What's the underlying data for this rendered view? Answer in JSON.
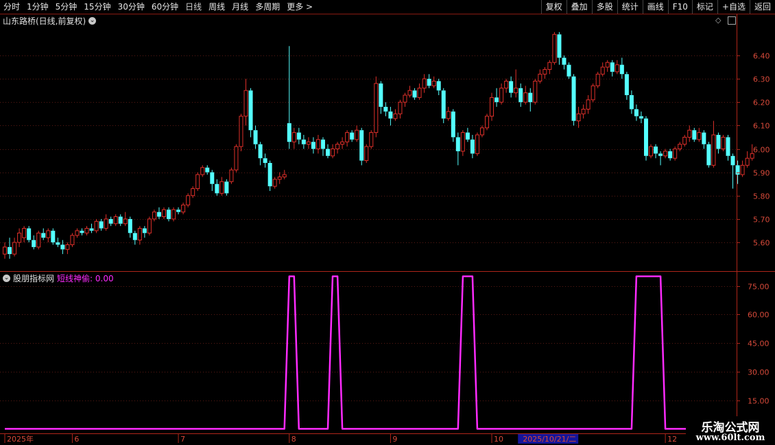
{
  "toolbar": {
    "periods": [
      "分时",
      "1分钟",
      "5分钟",
      "15分钟",
      "30分钟",
      "60分钟",
      "日线",
      "周线",
      "月线",
      "多周期",
      "更多 >"
    ],
    "active_period": "日线",
    "right_buttons": [
      "复权",
      "叠加",
      "多股",
      "统计",
      "画线",
      "F10",
      "标记",
      "+自选",
      "返回"
    ]
  },
  "main_panel": {
    "title": "山东路桥(日线,前复权)",
    "price_ticks": [
      "6.40",
      "6.30",
      "6.20",
      "6.10",
      "6.00",
      "5.90",
      "5.80",
      "5.70",
      "5.60"
    ],
    "price_range": [
      5.48,
      6.52
    ],
    "up_color": "#e0302a",
    "down_color": "#54ffff"
  },
  "indicator_panel": {
    "source": "股朋指标网",
    "indicator_label": "短线神偷: 0.00",
    "ticks": [
      "75.00",
      "60.00",
      "45.00",
      "30.00",
      "15.00"
    ],
    "value_range": [
      -2,
      82
    ],
    "line_color": "#ff2bff"
  },
  "date_axis": {
    "labels": [
      {
        "text": "2025年",
        "i": 0
      },
      {
        "text": "6",
        "i": 14
      },
      {
        "text": "7",
        "i": 36
      },
      {
        "text": "8",
        "i": 59
      },
      {
        "text": "9",
        "i": 80
      },
      {
        "text": "10",
        "i": 101
      },
      {
        "text": "2025/10/21/二",
        "i": 107,
        "highlight": true
      },
      {
        "text": "12",
        "i": 137
      }
    ]
  },
  "watermark": {
    "line1": "乐淘公式网",
    "line2": "www.60lt.com"
  },
  "chart_data": {
    "type": "candlestick",
    "candles": [
      [
        5.55,
        5.58,
        5.53,
        5.6
      ],
      [
        5.58,
        5.55,
        5.53,
        5.62
      ],
      [
        5.55,
        5.6,
        5.54,
        5.62
      ],
      [
        5.6,
        5.64,
        5.58,
        5.66
      ],
      [
        5.62,
        5.66,
        5.6,
        5.67
      ],
      [
        5.66,
        5.61,
        5.6,
        5.67
      ],
      [
        5.61,
        5.58,
        5.57,
        5.63
      ],
      [
        5.58,
        5.64,
        5.57,
        5.65
      ],
      [
        5.64,
        5.62,
        5.61,
        5.66
      ],
      [
        5.62,
        5.65,
        5.6,
        5.66
      ],
      [
        5.65,
        5.6,
        5.59,
        5.66
      ],
      [
        5.6,
        5.59,
        5.58,
        5.62
      ],
      [
        5.59,
        5.57,
        5.55,
        5.61
      ],
      [
        5.57,
        5.59,
        5.55,
        5.6
      ],
      [
        5.59,
        5.63,
        5.58,
        5.64
      ],
      [
        5.63,
        5.65,
        5.62,
        5.66
      ],
      [
        5.65,
        5.64,
        5.63,
        5.66
      ],
      [
        5.64,
        5.66,
        5.63,
        5.67
      ],
      [
        5.66,
        5.65,
        5.64,
        5.68
      ],
      [
        5.65,
        5.69,
        5.64,
        5.7
      ],
      [
        5.69,
        5.66,
        5.65,
        5.7
      ],
      [
        5.66,
        5.7,
        5.65,
        5.72
      ],
      [
        5.7,
        5.68,
        5.67,
        5.71
      ],
      [
        5.68,
        5.71,
        5.67,
        5.72
      ],
      [
        5.71,
        5.68,
        5.67,
        5.72
      ],
      [
        5.68,
        5.7,
        5.67,
        5.73
      ],
      [
        5.7,
        5.64,
        5.62,
        5.71
      ],
      [
        5.64,
        5.61,
        5.59,
        5.65
      ],
      [
        5.61,
        5.66,
        5.59,
        5.67
      ],
      [
        5.66,
        5.64,
        5.62,
        5.67
      ],
      [
        5.64,
        5.7,
        5.63,
        5.71
      ],
      [
        5.7,
        5.73,
        5.69,
        5.74
      ],
      [
        5.73,
        5.71,
        5.7,
        5.75
      ],
      [
        5.71,
        5.74,
        5.7,
        5.75
      ],
      [
        5.74,
        5.7,
        5.69,
        5.75
      ],
      [
        5.7,
        5.74,
        5.69,
        5.75
      ],
      [
        5.74,
        5.73,
        5.72,
        5.75
      ],
      [
        5.73,
        5.76,
        5.72,
        5.77
      ],
      [
        5.76,
        5.8,
        5.75,
        5.81
      ],
      [
        5.8,
        5.83,
        5.79,
        5.84
      ],
      [
        5.83,
        5.89,
        5.82,
        5.9
      ],
      [
        5.89,
        5.92,
        5.88,
        5.93
      ],
      [
        5.92,
        5.9,
        5.89,
        5.93
      ],
      [
        5.9,
        5.85,
        5.82,
        5.91
      ],
      [
        5.85,
        5.81,
        5.8,
        5.87
      ],
      [
        5.81,
        5.86,
        5.8,
        5.88
      ],
      [
        5.86,
        5.81,
        5.8,
        5.87
      ],
      [
        5.86,
        5.91,
        5.85,
        5.92
      ],
      [
        5.91,
        6.01,
        5.9,
        6.02
      ],
      [
        6.01,
        6.14,
        5.99,
        6.15
      ],
      [
        6.14,
        6.25,
        6.1,
        6.3
      ],
      [
        6.25,
        6.08,
        6.05,
        6.26
      ],
      [
        6.08,
        6.02,
        6.0,
        6.1
      ],
      [
        6.02,
        5.96,
        5.93,
        6.03
      ],
      [
        5.96,
        5.94,
        5.92,
        5.98
      ],
      [
        5.94,
        5.84,
        5.82,
        5.95
      ],
      [
        5.84,
        5.87,
        5.83,
        5.88
      ],
      [
        5.87,
        5.88,
        5.85,
        5.9
      ],
      [
        5.88,
        5.89,
        5.87,
        5.91
      ],
      [
        6.11,
        6.03,
        6.0,
        6.44
      ],
      [
        6.03,
        6.07,
        6.0,
        6.09
      ],
      [
        6.07,
        6.04,
        6.02,
        6.09
      ],
      [
        6.04,
        6.02,
        6.0,
        6.06
      ],
      [
        6.02,
        6.03,
        6.0,
        6.05
      ],
      [
        6.03,
        6.0,
        5.98,
        6.05
      ],
      [
        6.0,
        6.04,
        5.98,
        6.06
      ],
      [
        6.04,
        6.0,
        5.97,
        6.05
      ],
      [
        6.0,
        5.97,
        5.96,
        6.02
      ],
      [
        5.97,
        6.0,
        5.96,
        6.02
      ],
      [
        6.0,
        6.02,
        5.98,
        6.03
      ],
      [
        6.02,
        6.03,
        6.0,
        6.05
      ],
      [
        6.03,
        6.07,
        6.01,
        6.08
      ],
      [
        6.07,
        6.04,
        6.03,
        6.08
      ],
      [
        6.04,
        6.08,
        6.03,
        6.1
      ],
      [
        6.08,
        5.95,
        5.93,
        6.09
      ],
      [
        5.95,
        6.01,
        5.94,
        6.02
      ],
      [
        6.01,
        6.07,
        6.0,
        6.08
      ],
      [
        6.07,
        6.28,
        6.05,
        6.31
      ],
      [
        6.28,
        6.18,
        6.15,
        6.29
      ],
      [
        6.18,
        6.16,
        6.14,
        6.2
      ],
      [
        6.16,
        6.13,
        6.1,
        6.18
      ],
      [
        6.13,
        6.15,
        6.12,
        6.17
      ],
      [
        6.15,
        6.2,
        6.13,
        6.21
      ],
      [
        6.2,
        6.23,
        6.18,
        6.24
      ],
      [
        6.23,
        6.25,
        6.22,
        6.27
      ],
      [
        6.25,
        6.22,
        6.21,
        6.26
      ],
      [
        6.22,
        6.26,
        6.21,
        6.28
      ],
      [
        6.26,
        6.3,
        6.24,
        6.32
      ],
      [
        6.3,
        6.27,
        6.26,
        6.32
      ],
      [
        6.27,
        6.29,
        6.26,
        6.31
      ],
      [
        6.29,
        6.25,
        6.23,
        6.3
      ],
      [
        6.25,
        6.13,
        6.11,
        6.26
      ],
      [
        6.13,
        6.16,
        6.12,
        6.18
      ],
      [
        6.16,
        6.05,
        6.03,
        6.17
      ],
      [
        6.05,
        5.99,
        5.93,
        6.07
      ],
      [
        5.99,
        6.07,
        5.97,
        6.08
      ],
      [
        6.07,
        6.04,
        6.03,
        6.09
      ],
      [
        6.04,
        5.98,
        5.96,
        6.06
      ],
      [
        5.98,
        6.06,
        5.97,
        6.07
      ],
      [
        6.06,
        6.09,
        6.05,
        6.1
      ],
      [
        6.09,
        6.14,
        6.08,
        6.15
      ],
      [
        6.14,
        6.22,
        6.12,
        6.24
      ],
      [
        6.22,
        6.2,
        6.18,
        6.26
      ],
      [
        6.2,
        6.26,
        6.19,
        6.28
      ],
      [
        6.26,
        6.29,
        6.24,
        6.3
      ],
      [
        6.29,
        6.24,
        6.22,
        6.31
      ],
      [
        6.24,
        6.26,
        6.22,
        6.34
      ],
      [
        6.26,
        6.2,
        6.18,
        6.28
      ],
      [
        6.2,
        6.24,
        6.19,
        6.27
      ],
      [
        6.24,
        6.2,
        6.16,
        6.26
      ],
      [
        6.2,
        6.29,
        6.19,
        6.3
      ],
      [
        6.29,
        6.32,
        6.28,
        6.34
      ],
      [
        6.32,
        6.34,
        6.3,
        6.35
      ],
      [
        6.34,
        6.37,
        6.32,
        6.38
      ],
      [
        6.37,
        6.49,
        6.36,
        6.5
      ],
      [
        6.49,
        6.39,
        6.36,
        6.5
      ],
      [
        6.39,
        6.36,
        6.34,
        6.4
      ],
      [
        6.36,
        6.31,
        6.3,
        6.37
      ],
      [
        6.31,
        6.12,
        6.1,
        6.32
      ],
      [
        6.12,
        6.15,
        6.09,
        6.18
      ],
      [
        6.15,
        6.17,
        6.13,
        6.19
      ],
      [
        6.17,
        6.21,
        6.15,
        6.23
      ],
      [
        6.21,
        6.27,
        6.2,
        6.28
      ],
      [
        6.27,
        6.32,
        6.26,
        6.33
      ],
      [
        6.32,
        6.35,
        6.31,
        6.37
      ],
      [
        6.35,
        6.37,
        6.33,
        6.38
      ],
      [
        6.37,
        6.33,
        6.31,
        6.38
      ],
      [
        6.33,
        6.36,
        6.32,
        6.38
      ],
      [
        6.36,
        6.32,
        6.3,
        6.39
      ],
      [
        6.32,
        6.23,
        6.21,
        6.33
      ],
      [
        6.23,
        6.17,
        6.15,
        6.25
      ],
      [
        6.17,
        6.14,
        6.12,
        6.19
      ],
      [
        6.14,
        6.13,
        6.11,
        6.16
      ],
      [
        6.13,
        5.97,
        5.95,
        6.14
      ],
      [
        5.97,
        6.01,
        5.96,
        6.02
      ],
      [
        6.01,
        5.98,
        5.96,
        6.02
      ],
      [
        5.98,
        5.97,
        5.93,
        5.99
      ],
      [
        5.97,
        5.99,
        5.96,
        6.0
      ],
      [
        5.99,
        5.96,
        5.95,
        6.0
      ],
      [
        5.96,
        6.0,
        5.95,
        6.01
      ],
      [
        6.0,
        6.02,
        5.99,
        6.03
      ],
      [
        6.02,
        6.05,
        6.01,
        6.06
      ],
      [
        6.05,
        6.08,
        6.03,
        6.1
      ],
      [
        6.08,
        6.04,
        6.03,
        6.09
      ],
      [
        6.04,
        6.07,
        6.03,
        6.09
      ],
      [
        6.07,
        6.02,
        6.0,
        6.08
      ],
      [
        6.02,
        5.93,
        5.92,
        6.03
      ],
      [
        5.93,
        6.06,
        5.92,
        6.12
      ],
      [
        6.06,
        6.0,
        5.98,
        6.07
      ],
      [
        6.0,
        6.05,
        5.99,
        6.06
      ],
      [
        6.05,
        5.97,
        5.95,
        6.06
      ],
      [
        5.97,
        5.93,
        5.83,
        5.98
      ],
      [
        5.93,
        5.89,
        5.85,
        5.95
      ],
      [
        5.89,
        5.93,
        5.88,
        5.95
      ],
      [
        5.93,
        5.96,
        5.92,
        5.99
      ],
      [
        5.96,
        5.98,
        5.95,
        6.02
      ]
    ],
    "indicator": [
      0,
      0,
      0,
      0,
      0,
      0,
      0,
      0,
      0,
      0,
      0,
      0,
      0,
      0,
      0,
      0,
      0,
      0,
      0,
      0,
      0,
      0,
      0,
      0,
      0,
      0,
      0,
      0,
      0,
      0,
      0,
      0,
      0,
      0,
      0,
      0,
      0,
      0,
      0,
      0,
      0,
      0,
      0,
      0,
      0,
      0,
      0,
      0,
      0,
      0,
      0,
      0,
      0,
      0,
      0,
      0,
      0,
      0,
      0,
      80,
      80,
      0,
      0,
      0,
      0,
      0,
      0,
      0,
      80,
      80,
      0,
      0,
      0,
      0,
      0,
      0,
      0,
      0,
      0,
      0,
      0,
      0,
      0,
      0,
      0,
      0,
      0,
      0,
      0,
      0,
      0,
      0,
      0,
      0,
      0,
      80,
      80,
      80,
      0,
      0,
      0,
      0,
      0,
      0,
      0,
      0,
      0,
      0,
      0,
      0,
      0,
      0,
      0,
      0,
      0,
      0,
      0,
      0,
      0,
      0,
      0,
      0,
      0,
      0,
      0,
      0,
      0,
      0,
      0,
      0,
      0,
      80,
      80,
      80,
      80,
      80,
      80,
      0,
      0,
      0,
      0,
      0,
      0,
      0,
      0,
      0
    ]
  }
}
